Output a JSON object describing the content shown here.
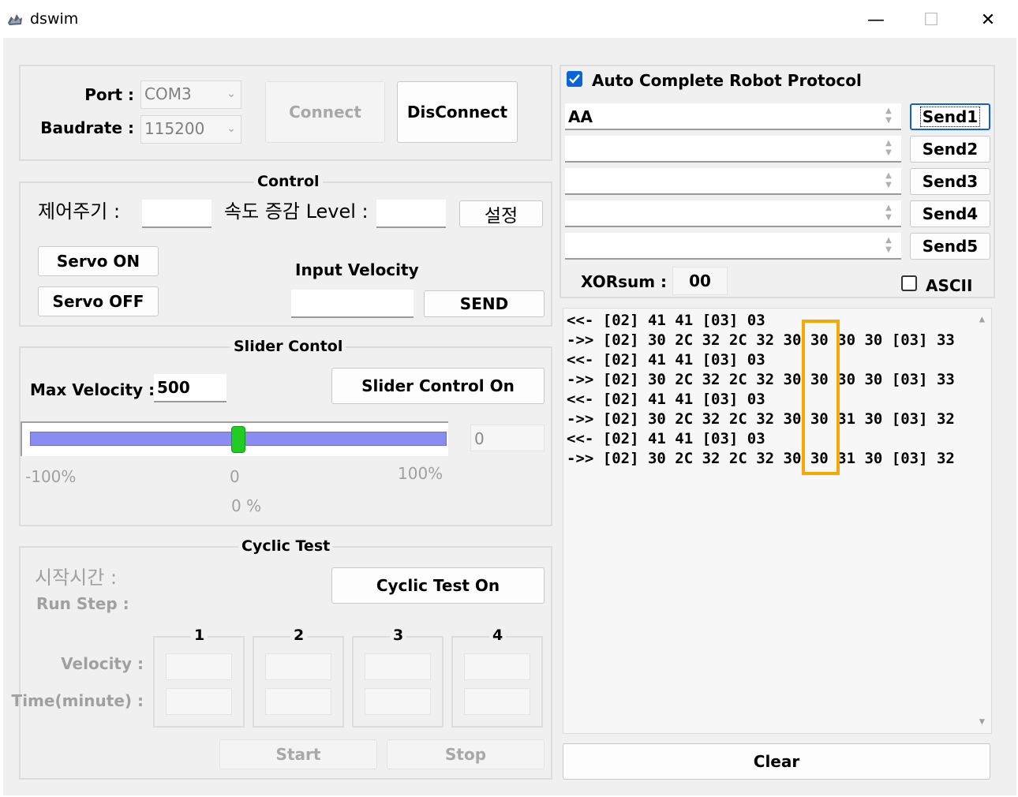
{
  "window": {
    "title": "dswim",
    "minimize_glyph": "—",
    "maximize_glyph": "☐",
    "close_glyph": "✕",
    "icon": "app-logo-icon"
  },
  "connection": {
    "port_label": "Port :",
    "port_value": "COM3",
    "baudrate_label": "Baudrate :",
    "baudrate_value": "115200",
    "connect_label": "Connect",
    "disconnect_label": "DisConnect"
  },
  "control": {
    "title": "Control",
    "period_label": "제어주기 :",
    "period_value": "",
    "speed_level_label": "속도 증감 Level :",
    "speed_level_value": "",
    "set_label": "설정",
    "servo_on_label": "Servo ON",
    "servo_off_label": "Servo OFF",
    "input_velocity_label": "Input Velocity",
    "input_velocity_value": "",
    "send_label": "SEND"
  },
  "slider": {
    "title": "Slider Contol",
    "max_velocity_label": "Max Velocity :",
    "max_velocity_value": "500",
    "slider_control_label": "Slider Control On",
    "value_display": "0",
    "min_label": "-100%",
    "mid_label": "0",
    "max_label": "100%",
    "percent_label": "0 %",
    "position_fraction": 0.5,
    "track_color": "#8a8cf0",
    "thumb_color": "#22cc22"
  },
  "cyclic": {
    "title": "Cyclic Test",
    "start_time_label": "시작시간 :",
    "run_step_label": "Run Step :",
    "cyclic_on_label": "Cyclic Test On",
    "velocity_label": "Velocity :",
    "time_label": "Time(minute) :",
    "steps": [
      "1",
      "2",
      "3",
      "4"
    ],
    "start_label": "Start",
    "stop_label": "Stop"
  },
  "protocol": {
    "auto_complete_label": "Auto Complete Robot Protocol",
    "auto_complete_checked": true,
    "rows": [
      {
        "value": "AA",
        "button": "Send1"
      },
      {
        "value": "",
        "button": "Send2"
      },
      {
        "value": "",
        "button": "Send3"
      },
      {
        "value": "",
        "button": "Send4"
      },
      {
        "value": "",
        "button": "Send5"
      }
    ],
    "xorsum_label": "XORsum :",
    "xorsum_value": "00",
    "ascii_label": "ASCII",
    "ascii_checked": false,
    "clear_label": "Clear",
    "accent_color": "#0a64d8",
    "highlight_color": "#f5a800"
  },
  "log": {
    "lines": [
      "<<- [02] 41 41 [03] 03",
      "->> [02] 30 2C 32 2C 32 30 30 30 30 [03] 33",
      "<<- [02] 41 41 [03] 03",
      "->> [02] 30 2C 32 2C 32 30 30 30 30 [03] 33",
      "<<- [02] 41 41 [03] 03",
      "->> [02] 30 2C 32 2C 32 30 30 31 30 [03] 32",
      "<<- [02] 41 41 [03] 03",
      "->> [02] 30 2C 32 2C 32 30 30 31 30 [03] 32"
    ]
  }
}
